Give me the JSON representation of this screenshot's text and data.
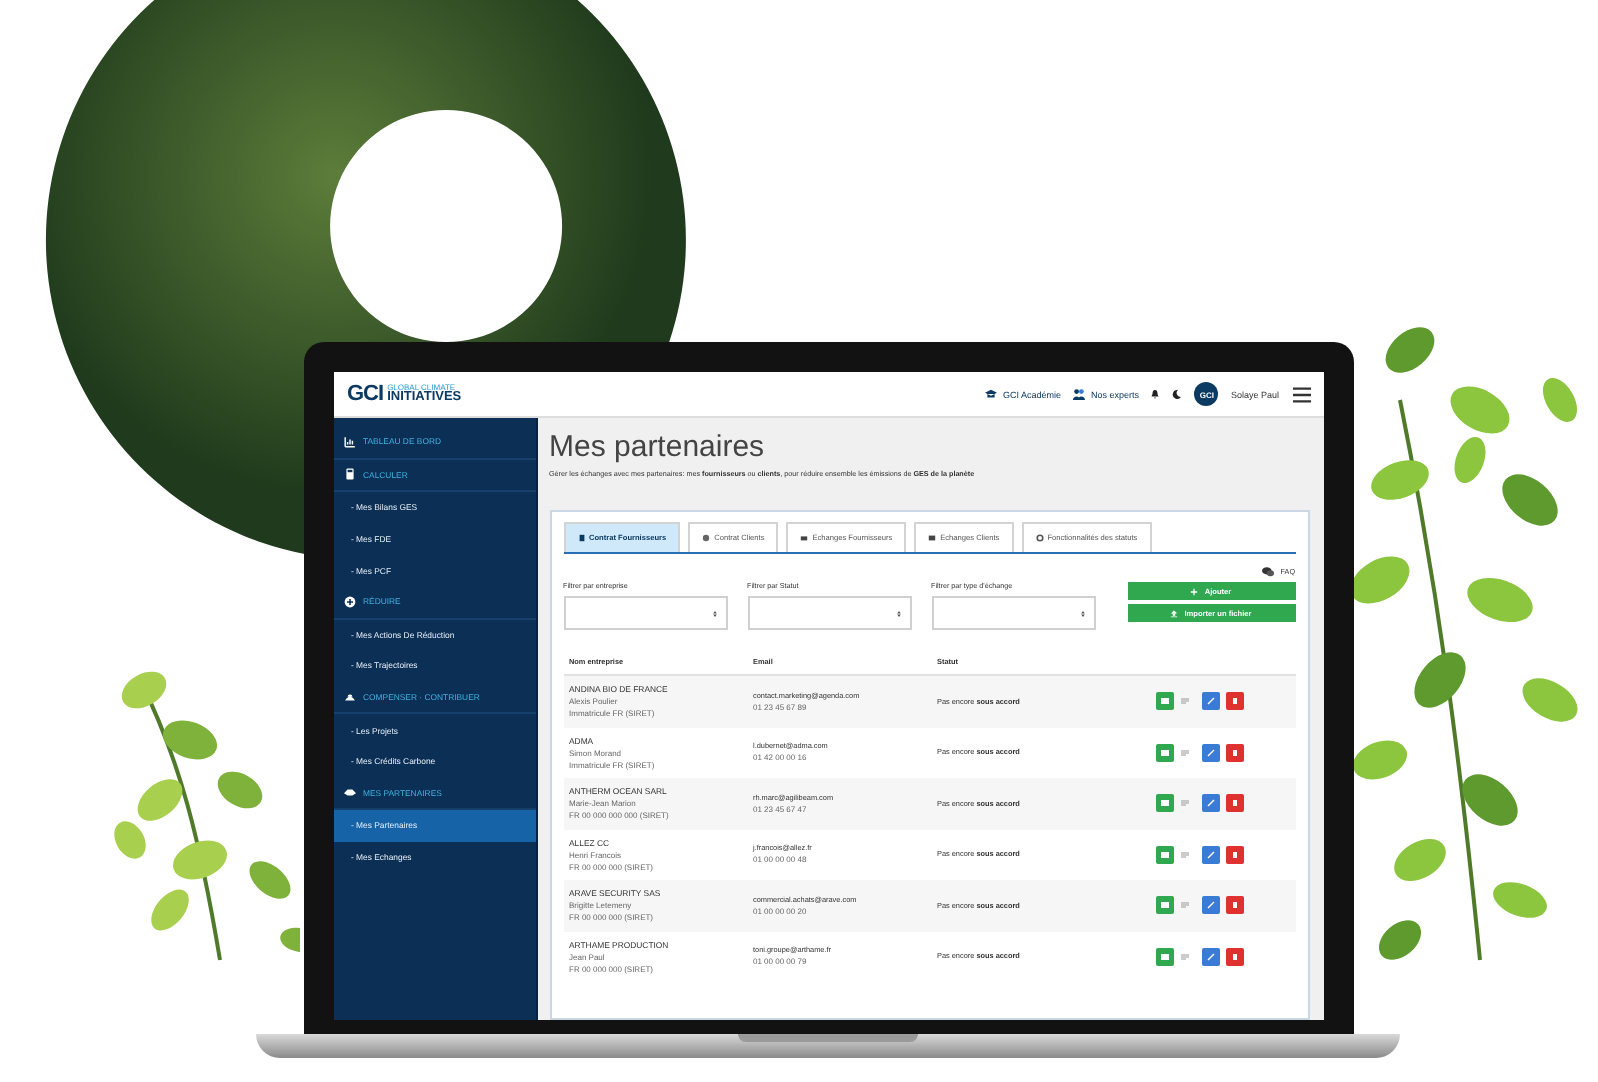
{
  "header": {
    "logo": {
      "mark": "GCI",
      "line1": "GLOBAL CLIMATE",
      "line2": "INITIATIVES"
    },
    "links": [
      "GCI Académie",
      "Nos experts"
    ],
    "avatar": "GCI",
    "user": "Solaye Paul"
  },
  "sidebar": {
    "items": [
      {
        "kind": "section",
        "label": "TABLEAU DE BORD",
        "selected": false
      },
      {
        "kind": "section",
        "label": "CALCULER",
        "selected": false
      },
      {
        "kind": "link",
        "label": "- Mes Bilans GES",
        "selected": false
      },
      {
        "kind": "link",
        "label": "- Mes FDE",
        "selected": false
      },
      {
        "kind": "link",
        "label": "- Mes PCF",
        "selected": false
      },
      {
        "kind": "section",
        "label": "RÉDUIRE",
        "selected": false
      },
      {
        "kind": "link",
        "label": "- Mes Actions De Réduction",
        "selected": false
      },
      {
        "kind": "link",
        "label": "- Mes Trajectoires",
        "selected": false
      },
      {
        "kind": "section",
        "label": "COMPENSER · CONTRIBUER",
        "selected": false
      },
      {
        "kind": "link",
        "label": "- Les Projets",
        "selected": false
      },
      {
        "kind": "link",
        "label": "- Mes Crédits Carbone",
        "selected": false
      },
      {
        "kind": "section",
        "label": "MES PARTENAIRES",
        "selected": false
      },
      {
        "kind": "link",
        "label": "- Mes Partenaires",
        "selected": true
      },
      {
        "kind": "link",
        "label": "- Mes Echanges",
        "selected": false
      }
    ]
  },
  "main": {
    "title": "Mes partenaires",
    "subtitle": "Gérer les échanges avec mes partenaires: mes **fournisseurs** ou **clients**, pour réduire ensemble les émissions de **GES de la planète**",
    "tabs": [
      {
        "label": "Contrat Fournisseurs",
        "selected": true
      },
      {
        "label": "Contrat Clients",
        "selected": false
      },
      {
        "label": "Echanges Fournisseurs",
        "selected": false
      },
      {
        "label": "Echanges Clients",
        "selected": false
      },
      {
        "label": "Fonctionnalités des statuts",
        "selected": false
      }
    ],
    "filters": [
      {
        "label": "Filtrer par entreprise"
      },
      {
        "label": "Filtrer par Statut"
      },
      {
        "label": "Filtrer par type d'échange"
      }
    ],
    "faq": "FAQ",
    "buttons": [
      {
        "kind": "add",
        "label": "Ajouter"
      },
      {
        "kind": "import",
        "label": "Importer un fichier"
      }
    ],
    "table": {
      "columns": [
        "Nom entreprise",
        "Email",
        "Statut"
      ],
      "rows": [
        {
          "name": "ANDINA BIO DE FRANCE",
          "contact": "Alexis Poulier",
          "id": "Immatricule FR (SIRET)",
          "email": "contact.marketing@agenda.com",
          "phone": "01 23 45 67 89",
          "status": "Pas encore **sous accord**"
        },
        {
          "name": "ADMA",
          "contact": "Simon Morand",
          "id": "Immatricule FR (SIRET)",
          "email": "l.dubernet@adma.com",
          "phone": "01 42 00 00 16",
          "status": "Pas encore **sous accord**"
        },
        {
          "name": "ANTHERM OCEAN SARL",
          "contact": "Marie-Jean Marion",
          "id": "FR 00 000 000 000 (SIRET)",
          "email": "rh.marc@agilibeam.com",
          "phone": "01 23 45 67 47",
          "status": "Pas encore **sous accord**"
        },
        {
          "name": "ALLEZ CC",
          "contact": "Henri Francois",
          "id": "FR 00 000 000 (SIRET)",
          "email": "j.francois@allez.fr",
          "phone": "01 00 00 00 48",
          "status": "Pas encore **sous accord**"
        },
        {
          "name": "ARAVE SECURITY SAS",
          "contact": "Brigitte Letemeny",
          "id": "FR 00 000 000 (SIRET)",
          "email": "commercial.achats@arave.com",
          "phone": "01 00 00 00 20",
          "status": "Pas encore **sous accord**"
        },
        {
          "name": "ARTHAME PRODUCTION",
          "contact": "Jean Paul",
          "id": "FR 00 000 000 (SIRET)",
          "email": "toni.groupe@arthame.fr",
          "phone": "01 00 00 00 79",
          "status": "Pas encore **sous accord**"
        }
      ]
    }
  }
}
